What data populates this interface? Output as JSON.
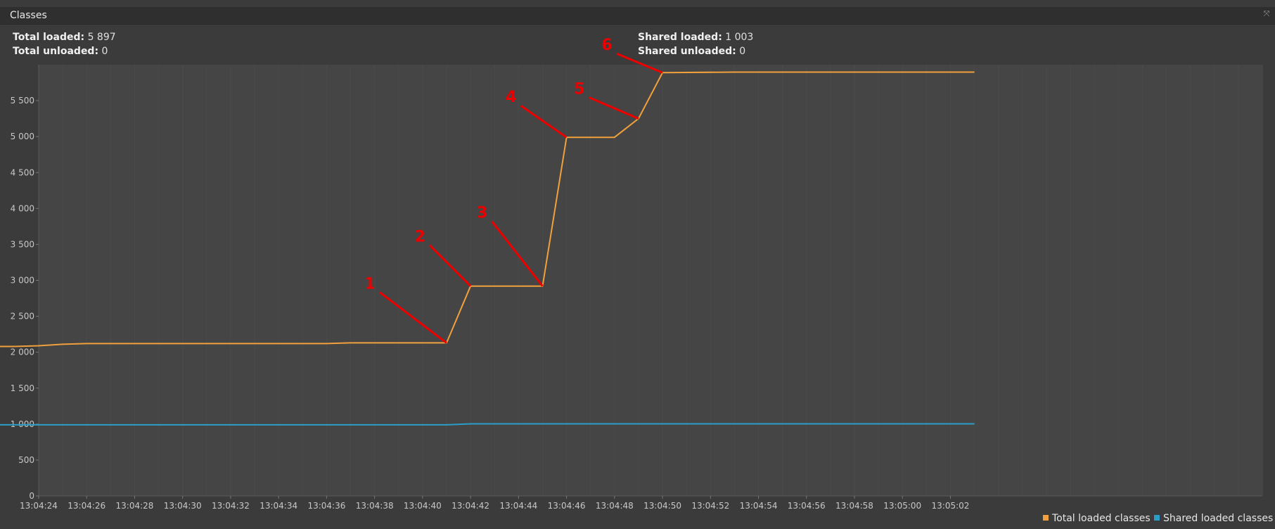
{
  "window": {
    "title": "Classes"
  },
  "stats": {
    "total_loaded_label": "Total loaded:",
    "total_loaded_value": "5 897",
    "total_unloaded_label": "Total unloaded:",
    "total_unloaded_value": "0",
    "shared_loaded_label": "Shared loaded:",
    "shared_loaded_value": "1 003",
    "shared_unloaded_label": "Shared unloaded:",
    "shared_unloaded_value": "0"
  },
  "legend": {
    "total_label": "Total loaded classes",
    "shared_label": "Shared loaded classes"
  },
  "colors": {
    "total": "#f0a03c",
    "shared": "#2a9ec8",
    "annotation": "#ee0000",
    "plot_bg": "#454545",
    "axis_text": "#c8c8c8"
  },
  "chart_data": {
    "type": "line",
    "x_unit": "seconds after 13:04:22",
    "ylim": [
      0,
      6000
    ],
    "y_ticks": [
      0,
      500,
      1000,
      1500,
      2000,
      2500,
      3000,
      3500,
      4000,
      4500,
      5000,
      5500
    ],
    "y_tick_labels": [
      "0",
      "500",
      "1 000",
      "1 500",
      "2 000",
      "2 500",
      "3 000",
      "3 500",
      "4 000",
      "4 500",
      "5 000",
      "5 500"
    ],
    "x_ticks": [
      "13:04:24",
      "13:04:26",
      "13:04:28",
      "13:04:30",
      "13:04:32",
      "13:04:34",
      "13:04:36",
      "13:04:38",
      "13:04:40",
      "13:04:42",
      "13:04:44",
      "13:04:46",
      "13:04:48",
      "13:04:50",
      "13:04:52",
      "13:04:54",
      "13:04:56",
      "13:04:58",
      "13:05:00",
      "13:05:02"
    ],
    "series": [
      {
        "name": "Total loaded classes",
        "points": [
          [
            "13:04:22",
            2080
          ],
          [
            "13:04:23",
            2080
          ],
          [
            "13:04:24",
            2090
          ],
          [
            "13:04:25",
            2110
          ],
          [
            "13:04:26",
            2120
          ],
          [
            "13:04:36",
            2120
          ],
          [
            "13:04:37",
            2130
          ],
          [
            "13:04:41",
            2130
          ],
          [
            "13:04:42",
            2920
          ],
          [
            "13:04:45",
            2920
          ],
          [
            "13:04:46",
            4990
          ],
          [
            "13:04:48",
            4990
          ],
          [
            "13:04:49",
            5250
          ],
          [
            "13:04:50",
            5890
          ],
          [
            "13:04:53",
            5897
          ],
          [
            "13:05:03",
            5897
          ]
        ]
      },
      {
        "name": "Shared loaded classes",
        "points": [
          [
            "13:04:22",
            990
          ],
          [
            "13:04:41",
            990
          ],
          [
            "13:04:42",
            1003
          ],
          [
            "13:05:03",
            1003
          ]
        ]
      }
    ],
    "annotations": [
      {
        "label": "1",
        "at": "13:04:41"
      },
      {
        "label": "2",
        "at": "13:04:42"
      },
      {
        "label": "3",
        "at": "13:04:45"
      },
      {
        "label": "4",
        "at": "13:04:46"
      },
      {
        "label": "5",
        "at": "13:04:49"
      },
      {
        "label": "6",
        "at": "13:04:50"
      }
    ]
  }
}
